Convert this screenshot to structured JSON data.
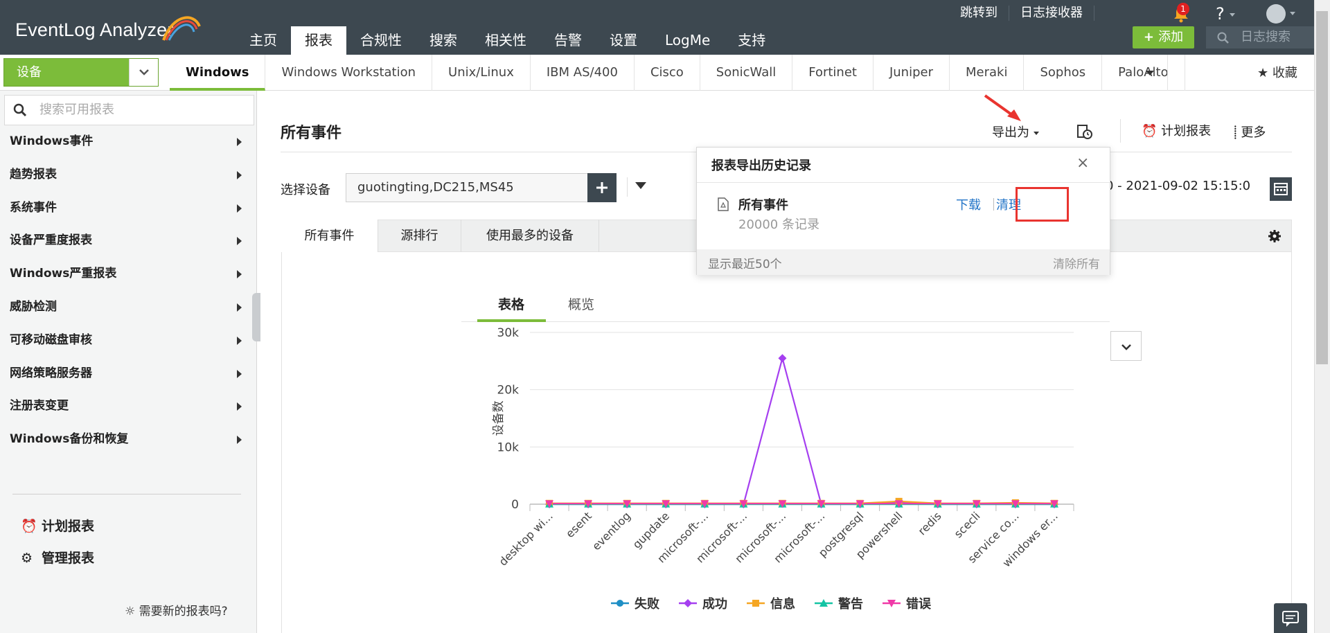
{
  "app": {
    "logo": "EventLog Analyzer",
    "nav_tabs": [
      "主页",
      "报表",
      "合规性",
      "搜索",
      "相关性",
      "告警",
      "设置",
      "LogMe",
      "支持"
    ],
    "nav_active": "报表",
    "top_links": [
      "跳转到",
      "日志接收器"
    ],
    "notification_count": "1",
    "help": "?",
    "add_label": "添加",
    "log_search_placeholder": "日志搜索"
  },
  "subnav": {
    "device_select": "设备",
    "os_tabs": [
      "Windows",
      "Windows Workstation",
      "Unix/Linux",
      "IBM AS/400",
      "Cisco",
      "SonicWall",
      "Fortinet",
      "Juniper",
      "Meraki",
      "Sophos",
      "PaloAlto"
    ],
    "favorite": "收藏"
  },
  "sidebar": {
    "search_placeholder": "搜索可用报表",
    "items": [
      "Windows事件",
      "趋势报表",
      "系统事件",
      "设备严重度报表",
      "Windows严重报表",
      "威胁检测",
      "可移动磁盘审核",
      "网络策略服务器",
      "注册表变更",
      "Windows备份和恢复"
    ],
    "links": [
      "计划报表",
      "管理报表"
    ],
    "need_report": "需要新的报表吗?"
  },
  "content": {
    "title": "所有事件",
    "export_label": "导出为",
    "schedule_label": "计划报表",
    "more_label": "更多",
    "device_label": "选择设备",
    "device_value": "guotingting,DC215,MS45",
    "date_range": "0 - 2021-09-02 15:15:0",
    "report_tabs": [
      "所有事件",
      "源排行",
      "使用最多的设备"
    ],
    "view_tabs": [
      "表格",
      "概览"
    ]
  },
  "popup": {
    "title": "报表导出历史记录",
    "close": "×",
    "file_name": "所有事件",
    "record_count": "20000 条记录",
    "download": "下载",
    "clean": "清理",
    "footer_left": "显示最近50个",
    "footer_right": "清除所有"
  },
  "chart_data": {
    "type": "line",
    "ylabel": "设备数",
    "ylim": [
      0,
      30000
    ],
    "yticks": [
      "0",
      "10k",
      "20k",
      "30k"
    ],
    "categories": [
      "desktop wi...",
      "esent",
      "eventlog",
      "gupdate",
      "microsoft-...",
      "microsoft-...",
      "microsoft-...",
      "microsoft-...",
      "postgresql",
      "powershell",
      "redis",
      "scecli",
      "service co...",
      "windows er..."
    ],
    "series": [
      {
        "name": "失败",
        "color": "#1f8fc5",
        "marker": "circle",
        "values": [
          0,
          0,
          0,
          0,
          0,
          0,
          0,
          0,
          0,
          0,
          0,
          0,
          0,
          0
        ]
      },
      {
        "name": "成功",
        "color": "#a53ff0",
        "marker": "diamond",
        "values": [
          0,
          0,
          0,
          0,
          0,
          0,
          25500,
          0,
          0,
          300,
          0,
          0,
          0,
          0
        ]
      },
      {
        "name": "信息",
        "color": "#f5a623",
        "marker": "square",
        "values": [
          150,
          150,
          150,
          150,
          150,
          150,
          150,
          150,
          150,
          500,
          150,
          150,
          250,
          150
        ]
      },
      {
        "name": "警告",
        "color": "#14c4a4",
        "marker": "triangle",
        "values": [
          0,
          0,
          0,
          0,
          0,
          0,
          0,
          0,
          0,
          0,
          0,
          0,
          0,
          0
        ]
      },
      {
        "name": "错误",
        "color": "#f03aa8",
        "marker": "triangle-down",
        "values": [
          100,
          100,
          100,
          100,
          100,
          100,
          100,
          100,
          100,
          100,
          100,
          100,
          100,
          100
        ]
      }
    ]
  }
}
